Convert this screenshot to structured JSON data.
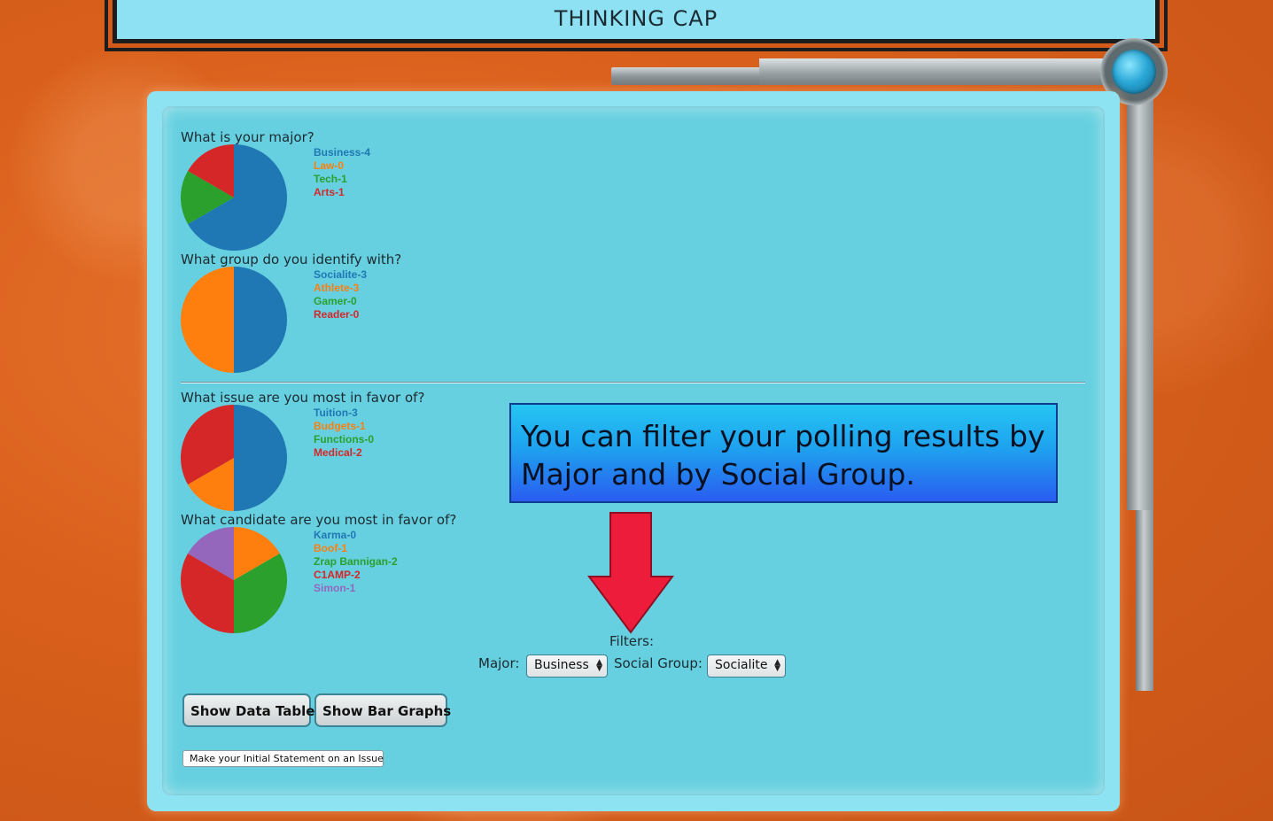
{
  "header": {
    "title": "THINKING CAP"
  },
  "colors": {
    "blue": "#1f77b4",
    "orange": "#ff7f0e",
    "green": "#2ca02c",
    "red": "#d62728",
    "purple": "#9467bd"
  },
  "polls": [
    {
      "question": "What is your major?",
      "legend": [
        "Business-4",
        "Law-0",
        "Tech-1",
        "Arts-1"
      ],
      "values": [
        4,
        0,
        1,
        1
      ]
    },
    {
      "question": "What group do you identify with?",
      "legend": [
        "Socialite-3",
        "Athlete-3",
        "Gamer-0",
        "Reader-0"
      ],
      "values": [
        3,
        3,
        0,
        0
      ]
    },
    {
      "question": "What issue are you most in favor of?",
      "legend": [
        "Tuition-3",
        "Budgets-1",
        "Functions-0",
        "Medical-2"
      ],
      "values": [
        3,
        1,
        0,
        2
      ]
    },
    {
      "question": "What candidate are you most in favor of?",
      "legend": [
        "Karma-0",
        "Boof-1",
        "Zrap Bannigan-2",
        "C1AMP-2",
        "Simon-1"
      ],
      "values": [
        0,
        1,
        2,
        2,
        1
      ]
    }
  ],
  "callout": {
    "text": "You can filter your polling results by Major and by Social Group."
  },
  "filters": {
    "heading": "Filters:",
    "major_label": "Major:",
    "major_value": "Business",
    "group_label": "Social Group:",
    "group_value": "Socialite"
  },
  "buttons": {
    "data_table": "Show Data Table",
    "bar_graphs": "Show Bar Graphs",
    "initial_statement": "Make your Initial Statement on an Issue"
  }
}
